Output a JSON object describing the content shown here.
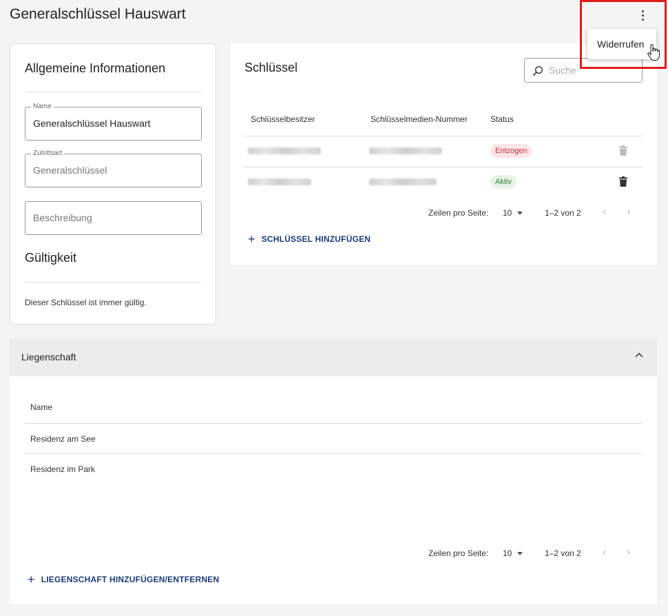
{
  "page": {
    "title": "Generalschlüssel Hauswart"
  },
  "menu": {
    "items": [
      "Widerrufen"
    ]
  },
  "info": {
    "title": "Allgemeine Informationen",
    "name_label": "Name",
    "name_value": "Generalschlüssel Hauswart",
    "access_label": "Zutrittsart",
    "access_value": "Generalschlüssel",
    "description_placeholder": "Beschreibung",
    "validity_title": "Gültigkeit",
    "validity_text": "Dieser Schlüssel ist immer gültig."
  },
  "keys": {
    "title": "Schlüssel",
    "search_placeholder": "Suche",
    "columns": [
      "Schlüsselbesitzer",
      "Schlüsselmedien-Nummer",
      "Status"
    ],
    "rows": [
      {
        "status": "Entzogen",
        "status_color": "#c0303a"
      },
      {
        "status": "Aktiv",
        "status_color": "#2e7d32"
      }
    ],
    "rows_per_page_label": "Zeilen pro Seite:",
    "rows_per_page": "10",
    "range": "1–2 von 2",
    "add_label": "SCHLÜSSEL HINZUFÜGEN"
  },
  "property": {
    "title": "Liegenschaft",
    "column": "Name",
    "rows": [
      "Residenz am See",
      "Residenz im Park"
    ],
    "rows_per_page_label": "Zeilen pro Seite:",
    "rows_per_page": "10",
    "range": "1–2 von 2",
    "add_label": "LIEGENSCHAFT HINZUFÜGEN/ENTFERNEN"
  },
  "colors": {
    "accent": "#1a3a7a",
    "highlight": "#e01b1b"
  }
}
